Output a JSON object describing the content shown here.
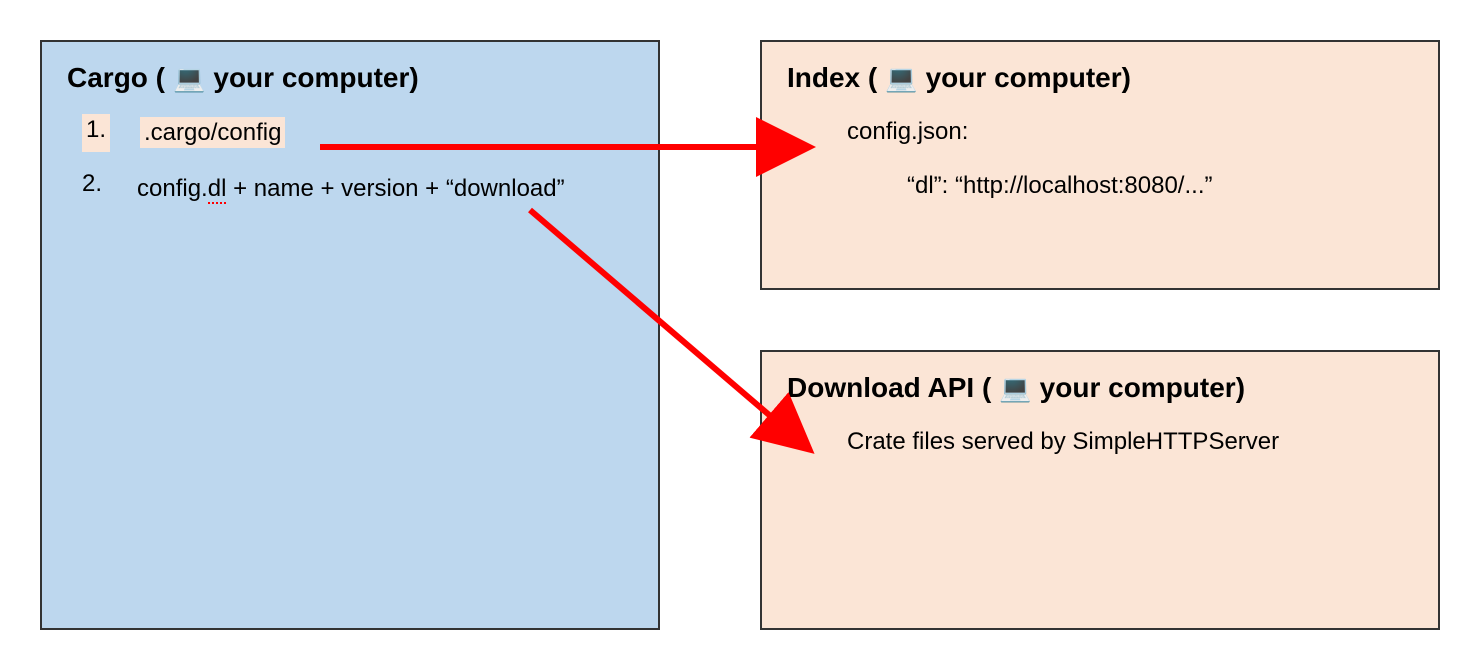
{
  "cargo": {
    "title_prefix": "Cargo (",
    "title_suffix": " your computer)",
    "items": [
      {
        "num": "1.",
        "text": ".cargo/config",
        "highlighted": true
      },
      {
        "num": "2.",
        "prefix": "config.",
        "underlined": "dl",
        "suffix": " + name + version + “download”"
      }
    ]
  },
  "index": {
    "title_prefix": "Index (",
    "title_suffix": " your computer)",
    "line1": "config.json:",
    "line2": "“dl”: “http://localhost:8080/...”"
  },
  "download": {
    "title_prefix": "Download API (",
    "title_suffix": " your computer)",
    "line1": "Crate files served by SimpleHTTPServer"
  },
  "colors": {
    "cargo_bg": "#bdd7ee",
    "orange_bg": "#fbe5d6",
    "arrow": "#ff0000"
  }
}
